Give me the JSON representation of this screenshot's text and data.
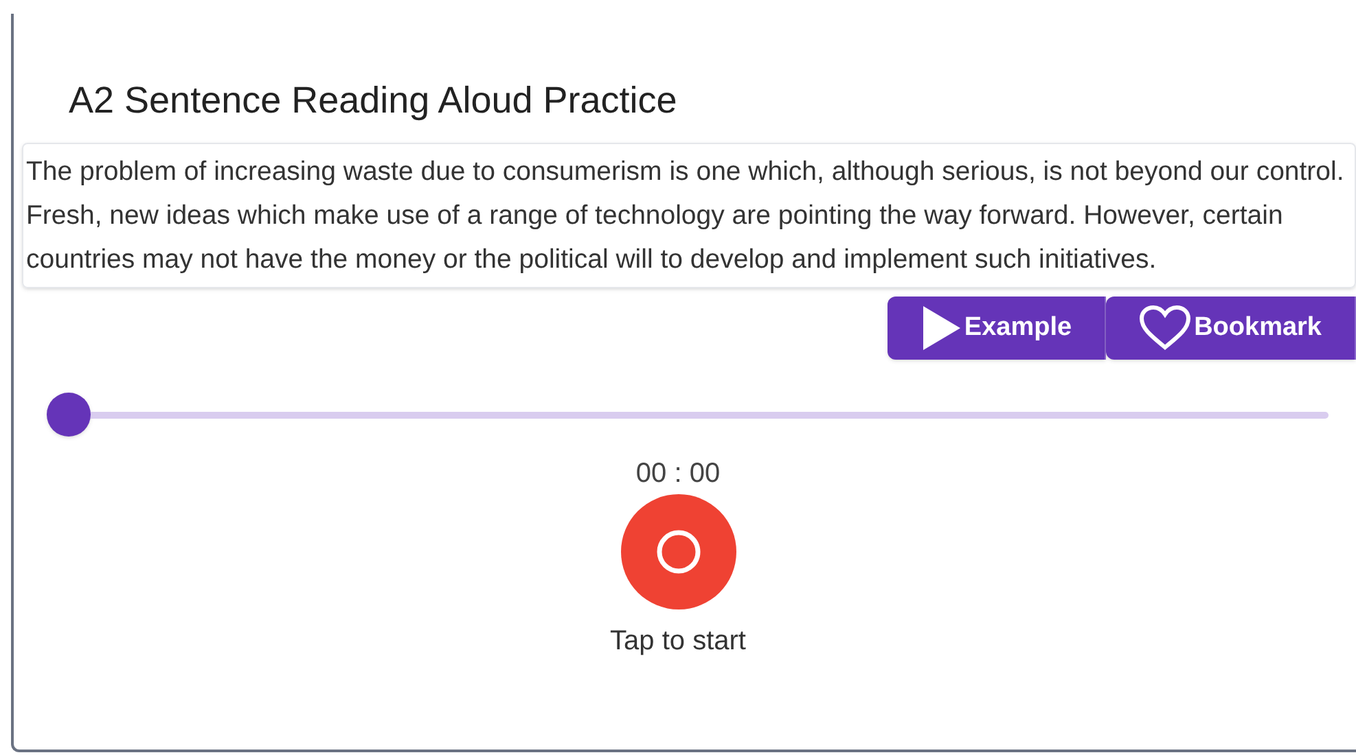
{
  "title": "A2 Sentence Reading Aloud Practice",
  "passage": "The problem of increasing waste due to consumerism is one which, although serious, is not beyond our control. Fresh, new ideas which make use of a range of technology are pointing the way forward. However, certain countries may not have the money or the political will to develop and implement such initiatives.",
  "buttons": [
    {
      "kind": "play",
      "label": "Example"
    },
    {
      "kind": "heart",
      "label": "Bookmark"
    }
  ],
  "slider": {
    "level": 0
  },
  "timer": "00 : 00",
  "record_hint": "Tap to start"
}
